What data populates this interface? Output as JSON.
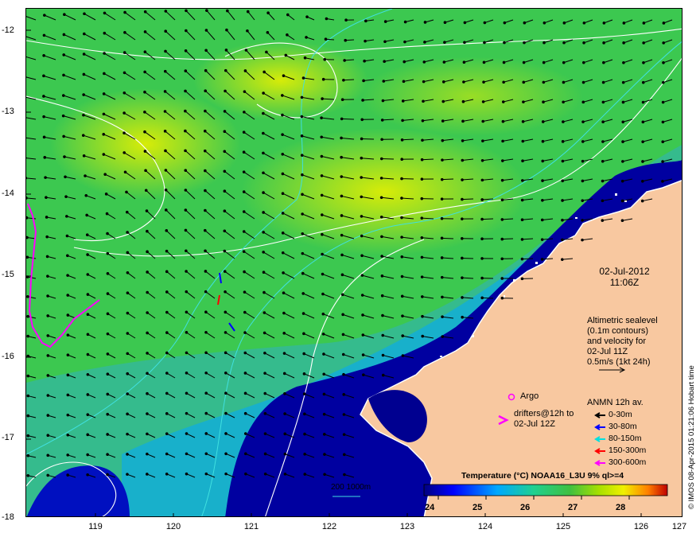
{
  "map": {
    "lon_range": [
      118.6,
      127.0
    ],
    "lat_range": [
      -18.0,
      -11.8
    ],
    "x_ticks": [
      119,
      120,
      121,
      122,
      123,
      124,
      125,
      126,
      127
    ],
    "y_ticks": [
      -12,
      -13,
      -14,
      -15,
      -16,
      -17,
      -18
    ],
    "x_tick_labels": [
      "119",
      "120",
      "121",
      "122",
      "123",
      "124",
      "125",
      "126",
      "127"
    ],
    "y_tick_labels": [
      "-12",
      "-13",
      "-14",
      "-15",
      "-16",
      "-17",
      "-18"
    ],
    "land_color": "#f8c8a0",
    "ocean_palette": [
      "#00007f",
      "#0000ff",
      "#00a8ff",
      "#20d090",
      "#40c040",
      "#a8e000",
      "#f0f000",
      "#ff8000",
      "#c00000"
    ]
  },
  "annotations": {
    "date": "02-Jul-2012",
    "time": "11:06Z",
    "altimetry_lines": [
      "Altimetric sealevel",
      "(0.1m contours)",
      "and velocity for",
      "02-Jul 11Z",
      "0.5m/s (1kt 24h)"
    ],
    "argo_label": "Argo",
    "drifters_lines": [
      "drifters@12h to",
      "02-Jul 12Z"
    ],
    "anmn_title": "ANMN 12h av.",
    "anmn_legend": [
      {
        "label": "0-30m",
        "color": "#000000"
      },
      {
        "label": "30-80m",
        "color": "#0000ff"
      },
      {
        "label": "80-150m",
        "color": "#00e0e0"
      },
      {
        "label": "150-300m",
        "color": "#ff0000"
      },
      {
        "label": "300-600m",
        "color": "#ff00ff"
      }
    ],
    "isobath_label": "200  1000m",
    "credit": "© IMOS 08-Apr-2015 01:21:06 Hobart time"
  },
  "colorbar": {
    "title": "Temperature (°C) NOAA16_L3U 9% ql>=4",
    "min": 23.7,
    "max": 28.8,
    "tick_labels": [
      "24",
      "25",
      "26",
      "27",
      "28"
    ]
  }
}
